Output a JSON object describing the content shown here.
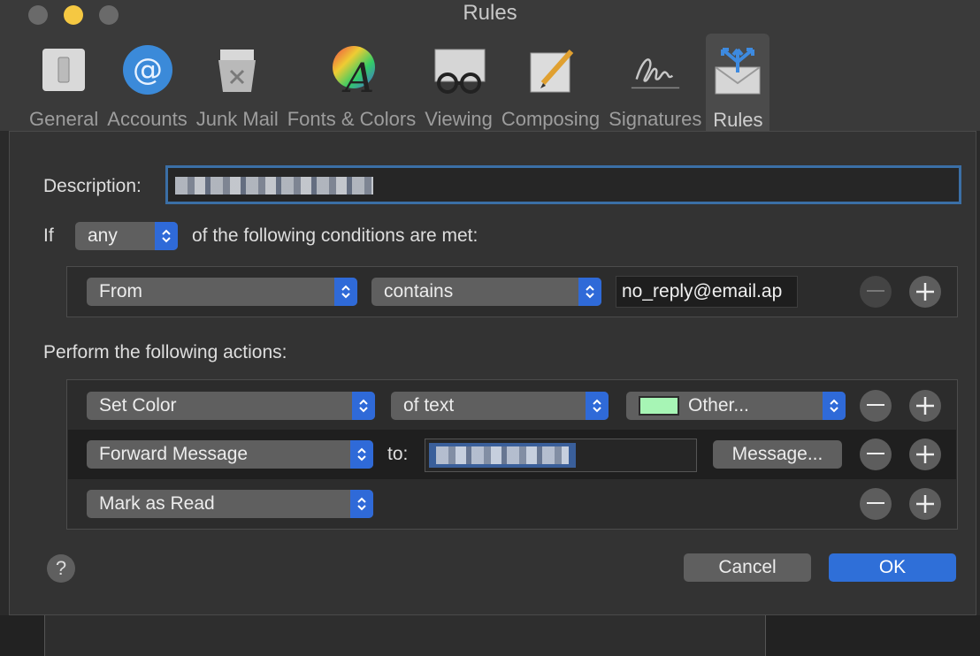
{
  "window": {
    "title": "Rules"
  },
  "toolbar": {
    "items": [
      {
        "label": "General",
        "icon": "switch-icon"
      },
      {
        "label": "Accounts",
        "icon": "at-sign-icon"
      },
      {
        "label": "Junk Mail",
        "icon": "trash-bin-icon"
      },
      {
        "label": "Fonts & Colors",
        "icon": "font-color-wheel-icon"
      },
      {
        "label": "Viewing",
        "icon": "glasses-envelope-icon"
      },
      {
        "label": "Composing",
        "icon": "pencil-paper-icon"
      },
      {
        "label": "Signatures",
        "icon": "signature-icon"
      },
      {
        "label": "Rules",
        "icon": "envelope-arrows-icon"
      }
    ],
    "active": "Rules"
  },
  "form": {
    "description_label": "Description:",
    "if_label": "If",
    "match_value": "any",
    "conditions_label": "of the following conditions are met:",
    "condition": {
      "field": "From",
      "operator": "contains",
      "value": "no_reply@email.ap"
    },
    "actions_label": "Perform the following actions:",
    "actions": [
      {
        "action": "Set Color",
        "target": "of text",
        "color_label": "Other...",
        "color": "#a7f5b5"
      },
      {
        "action": "Forward Message",
        "to_label": "to:",
        "message_button": "Message..."
      },
      {
        "action": "Mark as Read"
      }
    ]
  },
  "buttons": {
    "help": "?",
    "cancel": "Cancel",
    "ok": "OK"
  },
  "colors": {
    "accent": "#2f6fd8",
    "background": "#333333"
  }
}
